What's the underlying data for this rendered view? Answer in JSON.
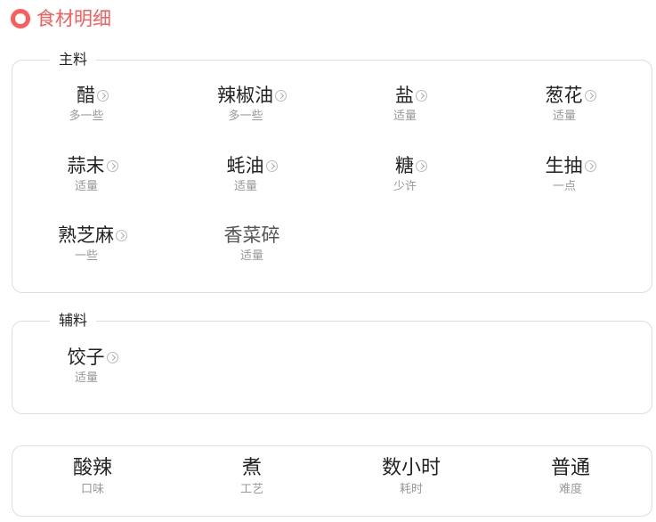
{
  "section_title": "食材明细",
  "main": {
    "legend": "主料",
    "items": [
      {
        "name": "醋",
        "amount": "多一些"
      },
      {
        "name": "辣椒油",
        "amount": "多一些"
      },
      {
        "name": "盐",
        "amount": "适量"
      },
      {
        "name": "葱花",
        "amount": "适量"
      },
      {
        "name": "蒜末",
        "amount": "适量"
      },
      {
        "name": "蚝油",
        "amount": "适量"
      },
      {
        "name": "糖",
        "amount": "少许"
      },
      {
        "name": "生抽",
        "amount": "一点"
      },
      {
        "name": "熟芝麻",
        "amount": "一些"
      },
      {
        "name": "香菜碎",
        "amount": "适量"
      }
    ]
  },
  "secondary": {
    "legend": "辅料",
    "items": [
      {
        "name": "饺子",
        "amount": "适量"
      }
    ]
  },
  "summary": [
    {
      "value": "酸辣",
      "label": "口味"
    },
    {
      "value": "煮",
      "label": "工艺"
    },
    {
      "value": "数小时",
      "label": "耗时"
    },
    {
      "value": "普通",
      "label": "难度"
    }
  ]
}
